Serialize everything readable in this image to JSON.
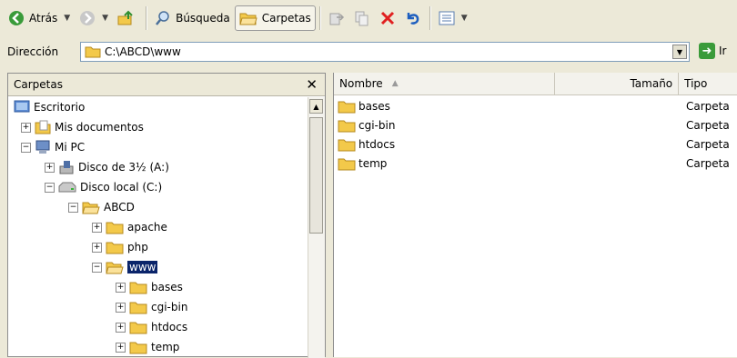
{
  "toolbar": {
    "back_label": "Atrás",
    "search_label": "Búsqueda",
    "folders_label": "Carpetas"
  },
  "address": {
    "label": "Dirección",
    "path": "C:\\ABCD\\www",
    "go_label": "Ir"
  },
  "folders_pane": {
    "title": "Carpetas",
    "tree": [
      {
        "label": "Escritorio"
      },
      {
        "label": "Mis documentos"
      },
      {
        "label": "Mi PC"
      },
      {
        "label": "Disco de 3½ (A:)"
      },
      {
        "label": "Disco local (C:)"
      },
      {
        "label": "ABCD"
      },
      {
        "label": "apache"
      },
      {
        "label": "php"
      },
      {
        "label": "www"
      },
      {
        "label": "bases"
      },
      {
        "label": "cgi-bin"
      },
      {
        "label": "htdocs"
      },
      {
        "label": "temp"
      }
    ]
  },
  "file_list": {
    "columns": [
      "Nombre",
      "Tamaño",
      "Tipo"
    ],
    "rows": [
      {
        "name": "bases",
        "size": "",
        "type": "Carpeta"
      },
      {
        "name": "cgi-bin",
        "size": "",
        "type": "Carpeta"
      },
      {
        "name": "htdocs",
        "size": "",
        "type": "Carpeta"
      },
      {
        "name": "temp",
        "size": "",
        "type": "Carpeta"
      }
    ]
  },
  "colors": {
    "selection": "#0a246a",
    "folder": "#f3c94a",
    "window": "#ece9d8"
  }
}
